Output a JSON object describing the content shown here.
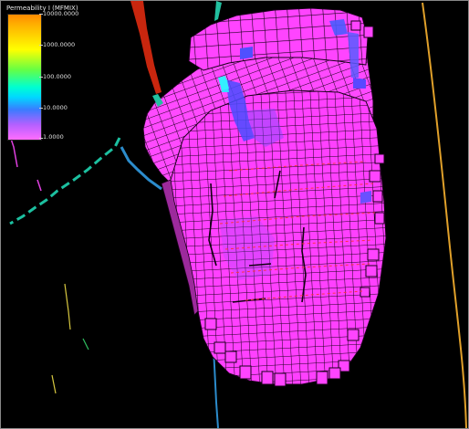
{
  "legend": {
    "title": "Permeability I (MFMIX)",
    "ticks": [
      "10000.0000",
      "1000.0000",
      "100.0000",
      "10.0000",
      "1.0000"
    ]
  },
  "colors": {
    "background": "#000000",
    "cell_fill": "#ff44ff",
    "cell_edge": "#000000",
    "high_perm": "#4a4cff",
    "fault_red": "#c8260e",
    "fault_orange": "#e0a02a",
    "fault_teal": "#18b8a0",
    "fault_blue": "#2c8ccc",
    "fault_yellow": "#d8c840"
  }
}
